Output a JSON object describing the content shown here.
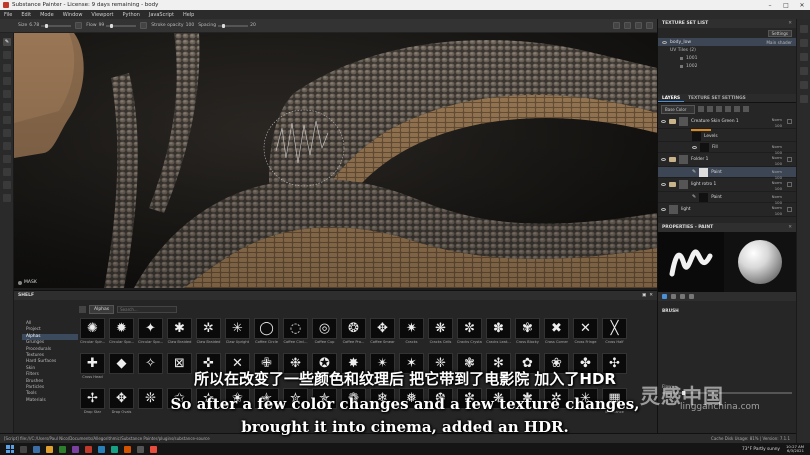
{
  "window": {
    "title": "Substance Painter - License: 9 days remaining - body"
  },
  "menu": [
    "File",
    "Edit",
    "Mode",
    "Window",
    "Viewport",
    "Python",
    "JavaScript",
    "Help"
  ],
  "toolbar": {
    "size_label": "Size",
    "size_value": "6.78",
    "flow_label": "Flow",
    "flow_value": "99",
    "stroke_opacity_label": "Stroke opacity",
    "stroke_opacity_value": "100",
    "spacing_label": "Spacing",
    "spacing_value": "20"
  },
  "viewport": {
    "mask_label": "MASK"
  },
  "shelf": {
    "title": "SHELF",
    "filter_chip": "Alphas",
    "search_placeholder": "Search...",
    "categories": [
      "All",
      "Project",
      "Alphas",
      "Grunges",
      "Procedurals",
      "Textures",
      "Hard Surfaces",
      "Skin",
      "Filters",
      "Brushes",
      "Particles",
      "Tools",
      "Materials"
    ],
    "active_category": "Alphas",
    "alphas_row1": [
      "Circular Spir...",
      "Circular Spo...",
      "Circular Spo...",
      "Claw Braided",
      "Claw Braided",
      "Claw Upright",
      "Coffee Circle",
      "Coffee Circl...",
      "Coffee Cup",
      "Coffee Pro...",
      "Coffee Smear",
      "Cracks",
      "Cracks Cells",
      "Cracks Crystal",
      "Cracks Leat...",
      "Cross Blocky",
      "Cross Corner",
      "Cross Fringe",
      "Cross Half"
    ],
    "alphas_row2": [
      "Cross Head",
      "",
      "",
      "",
      "",
      "",
      "",
      "",
      "",
      "",
      "",
      "",
      "",
      "",
      "",
      "",
      "",
      "",
      ""
    ],
    "alphas_row3": [
      "Drop Star",
      "Drop Ovals",
      "",
      "",
      "",
      "",
      "",
      "",
      "",
      "",
      "",
      "",
      "",
      "",
      "",
      "",
      "",
      "",
      "Substance"
    ]
  },
  "texture_set_list": {
    "title": "TEXTURE SET LIST",
    "settings_btn": "Settings",
    "set_name": "body_low",
    "shader": "Main shader",
    "uv_tiles_label": "UV Tiles (2)",
    "tiles": [
      "1001",
      "1002"
    ]
  },
  "tabs": {
    "layers": "LAYERS",
    "texture_set_settings": "TEXTURE SET SETTINGS"
  },
  "layers": {
    "channel_select": "Base Color",
    "items": [
      {
        "name": "Creature Skin Green 1",
        "blend": "Norm",
        "opacity": "100"
      },
      {
        "name": "Levels",
        "sub": true
      },
      {
        "name": "Fill",
        "blend": "Norm",
        "opacity": "100",
        "sub": true
      },
      {
        "name": "Folder 1",
        "blend": "Norm",
        "opacity": "100"
      },
      {
        "name": "Paint",
        "blend": "Norm",
        "opacity": "100",
        "sub": true
      },
      {
        "name": "light rotro 1",
        "blend": "Norm",
        "opacity": "100"
      },
      {
        "name": "Paint",
        "blend": "Norm",
        "opacity": "100",
        "sub": true
      },
      {
        "name": "light",
        "blend": "Norm",
        "opacity": "100"
      }
    ]
  },
  "properties": {
    "title": "PROPERTIES - PAINT",
    "brush_section": "BRUSH",
    "flow_label": "Flow"
  },
  "statusbar": {
    "path": "[Script] file:///C:/Users/Paul Nico/Documents/Allegorithmic/Substance Painter/plugins/substance-source",
    "cache": "Cache Disk Usage: 81% | Version: 7.1.1"
  },
  "taskbar": {
    "weather": "73°F Partly sunny",
    "time": "10:27 AM",
    "date": "6/3/2021"
  },
  "subtitles": {
    "cn": "所以在改变了一些颜色和纹理后 把它带到了电影院 加入了HDR",
    "en_line1": "So after a few color changes and a few texture changes,",
    "en_line2": "brought it into cinema, added an HDR."
  },
  "watermark": {
    "logo": "灵感中国",
    "url": "lingganchina.com"
  },
  "colors": {
    "accent": "#4a90d9",
    "selection": "#3c4654",
    "folder": "#c9b38a",
    "mask_orange": "#d98a1e"
  }
}
